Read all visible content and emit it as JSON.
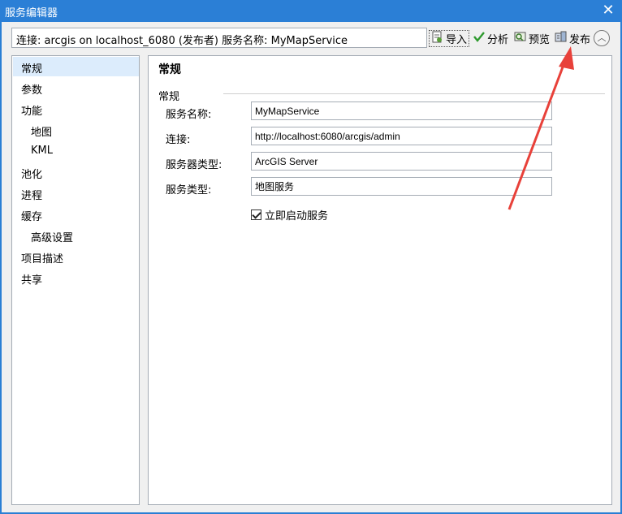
{
  "window": {
    "title": "服务编辑器",
    "close_glyph": "✕"
  },
  "connection": {
    "text": "连接: arcgis on localhost_6080 (发布者)   服务名称: MyMapService"
  },
  "toolbar": {
    "import_label": "导入",
    "analyze_label": "分析",
    "preview_label": "预览",
    "publish_label": "发布",
    "collapse_glyph": "︿"
  },
  "nav": {
    "items": [
      {
        "label": "常规"
      },
      {
        "label": "参数"
      },
      {
        "label": "功能"
      },
      {
        "label": "地图"
      },
      {
        "label": "KML"
      },
      {
        "label": "池化"
      },
      {
        "label": "进程"
      },
      {
        "label": "缓存"
      },
      {
        "label": "高级设置"
      },
      {
        "label": "项目描述"
      },
      {
        "label": "共享"
      }
    ]
  },
  "panel": {
    "title": "常规",
    "section": "常规",
    "fields": [
      {
        "label": "服务名称:",
        "value": "MyMapService"
      },
      {
        "label": "连接:",
        "value": "http://localhost:6080/arcgis/admin"
      },
      {
        "label": "服务器类型:",
        "value": "ArcGIS Server"
      },
      {
        "label": "服务类型:",
        "value": "地图服务"
      }
    ],
    "start_service_label": "立即启动服务"
  },
  "colors": {
    "titlebar": "#2b7fd6",
    "selection": "#dcecfc",
    "annotation_arrow": "#e8413a"
  }
}
